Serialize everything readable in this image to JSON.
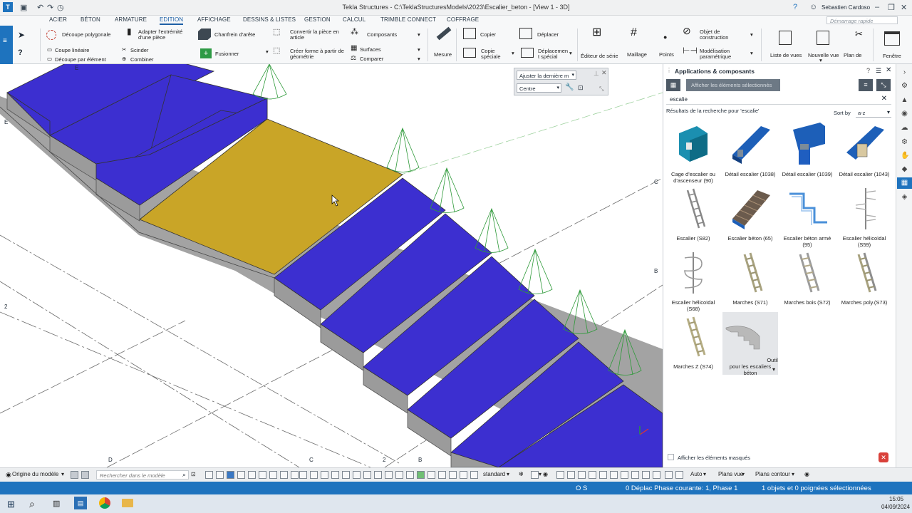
{
  "titlebar": {
    "title": "Tekla Structures - C:\\TeklaStructuresModels\\2023\\Escalier_beton  - [View 1 - 3D]",
    "user": "Sebastien Cardoso",
    "quick_search_placeholder": "Démarrage rapide"
  },
  "menu_tabs": [
    "ACIER",
    "BÉTON",
    "ARMATURE",
    "EDITION",
    "AFFICHAGE",
    "DESSINS & LISTES",
    "GESTION",
    "CALCUL",
    "TRIMBLE CONNECT",
    "COFFRAGE"
  ],
  "active_tab": "EDITION",
  "ribbon": {
    "decoupe_polygonale": "Découpe polygonale",
    "coupe_lineaire": "Coupe linéaire",
    "decoupe_par_element": "Découpe par élément",
    "adapter_1": "Adapter l'extrémité",
    "adapter_2": "d'une pièce",
    "scinder": "Scinder",
    "combiner": "Combiner",
    "chanfrein": "Chanfrein d'arête",
    "fusionner": "Fusionner",
    "convertir_1": "Convertir la pièce en",
    "convertir_2": "article",
    "creer_forme_1": "Créer forme à partir de",
    "creer_forme_2": "géométrie",
    "composants": "Composants",
    "surfaces": "Surfaces",
    "comparer": "Comparer",
    "mesure": "Mesure",
    "copier": "Copier",
    "copie_speciale_1": "Copie",
    "copie_speciale_2": "spéciale",
    "deplacer": "Déplacer",
    "deplacement_1": "Déplacemen",
    "deplacement_2": "t spécial",
    "editeur_serie": "Éditeur de série",
    "maillage": "Maillage",
    "points": "Points",
    "objet_construction_1": "Objet de",
    "objet_construction_2": "construction",
    "modelisation_1": "Modélisation",
    "modelisation_2": "paramétrique",
    "liste_vues": "Liste de vues",
    "nouvelle_vue": "Nouvelle vue",
    "plan_de": "Plan de",
    "fenetre": "Fenêtre"
  },
  "view_popup": {
    "fit_label": "Ajuster la dernière m",
    "center_label": "Centre"
  },
  "panel": {
    "title": "Applications & composants",
    "show_selected": "Afficher les éléments sélectionnés",
    "search_value": "escalie",
    "results_label": "Résultats de la recherche pour 'escalie'",
    "sort_label": "Sort by",
    "sort_value": "a-z",
    "show_hidden": "Afficher les éléments masqués",
    "components": [
      {
        "label": "Cage d'escalier ou d'ascenseur (90)",
        "icon": "stair-core-icon"
      },
      {
        "label": "Détail escalier (1038)",
        "icon": "stair-detail-icon"
      },
      {
        "label": "Détail escalier (1039)",
        "icon": "stair-detail-icon"
      },
      {
        "label": "Détail escalier (1043)",
        "icon": "stair-detail-icon"
      },
      {
        "label": "Escalier (S82)",
        "icon": "ladder-icon"
      },
      {
        "label": "Escalier béton (65)",
        "icon": "concrete-stair-icon"
      },
      {
        "label": "Escalier béton armé (95)",
        "icon": "reinforced-stair-icon"
      },
      {
        "label": "Escalier hélicoïdal (S59)",
        "icon": "spiral-stair-icon"
      },
      {
        "label": "Escalier hélicoïdal (S68)",
        "icon": "spiral-stair-icon"
      },
      {
        "label": "Marches (S71)",
        "icon": "stringer-stair-icon"
      },
      {
        "label": "Marches bois (S72)",
        "icon": "wood-stair-icon"
      },
      {
        "label": "Marches poly.(S73)",
        "icon": "poly-stair-icon"
      },
      {
        "label": "Marches Z (S74)",
        "icon": "z-stair-icon"
      },
      {
        "label": "Outil pour les escaliers béton",
        "icon": "concrete-stair-tool-icon"
      }
    ]
  },
  "grid_labels": {
    "e_top": "E",
    "e_left": "E",
    "c_right": "C",
    "b_right": "B",
    "two_left": "2",
    "d_bottom": "D",
    "c_bottom": "C",
    "two_bottom": "2",
    "b_bottom": "B"
  },
  "bottombar": {
    "origin": "Origine du modèle",
    "search_placeholder": "Rechercher dans le modèle",
    "standard": "standard",
    "auto": "Auto",
    "plans_vue": "Plans vue",
    "plans_contour": "Plans contour"
  },
  "statusbar": {
    "os": "O  S",
    "phase": "0  Déplac Phase courante: 1, Phase 1",
    "selection": "1 objets et 0 poignées sélectionnées"
  },
  "taskbar": {
    "time": "15:05",
    "date": "04/09/2024"
  },
  "colors": {
    "tread_blue": "#3c2fd0",
    "selected_tread": "#c9a527",
    "concrete_grey": "#9c9c9c",
    "support_green": "#2f9a3a",
    "accent": "#1e73be"
  }
}
